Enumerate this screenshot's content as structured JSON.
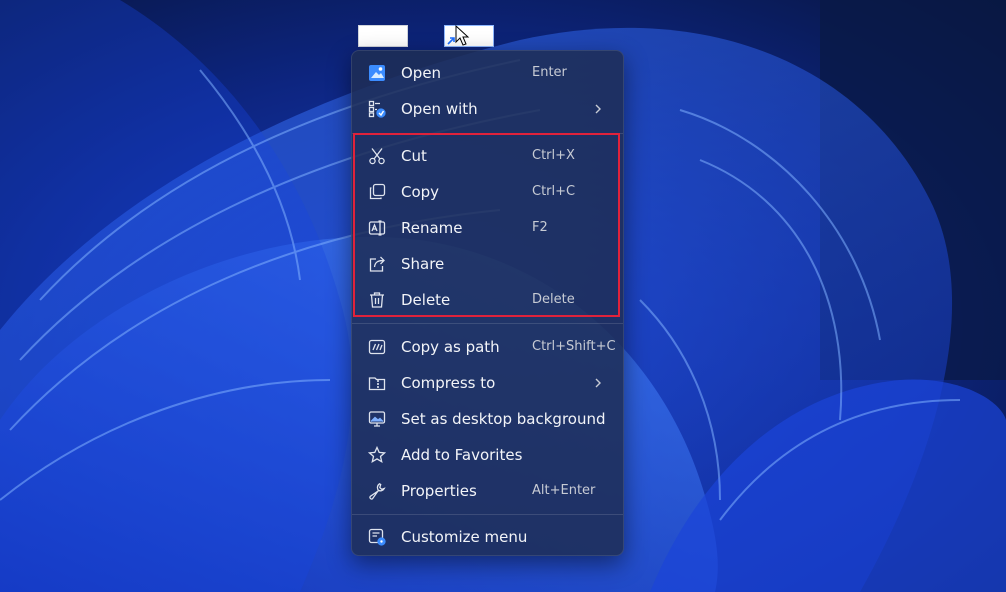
{
  "colors": {
    "highlight": "#e0223b",
    "menu_background": "#1e2d55",
    "menu_text": "#f2f4f8",
    "accent": "#1e5bff"
  },
  "menu": {
    "items": [
      {
        "label": "Open",
        "shortcut": "Enter",
        "icon": "image-file-icon"
      },
      {
        "label": "Open with",
        "shortcut": "",
        "icon": "open-with-icon",
        "submenu": true
      },
      {
        "label": "Cut",
        "shortcut": "Ctrl+X",
        "icon": "scissors-icon"
      },
      {
        "label": "Copy",
        "shortcut": "Ctrl+C",
        "icon": "copy-icon"
      },
      {
        "label": "Rename",
        "shortcut": "F2",
        "icon": "rename-icon"
      },
      {
        "label": "Share",
        "shortcut": "",
        "icon": "share-icon"
      },
      {
        "label": "Delete",
        "shortcut": "Delete",
        "icon": "trash-icon"
      },
      {
        "label": "Copy as path",
        "shortcut": "Ctrl+Shift+C",
        "icon": "copy-path-icon"
      },
      {
        "label": "Compress to",
        "shortcut": "",
        "icon": "zip-folder-icon",
        "submenu": true
      },
      {
        "label": "Set as desktop background",
        "shortcut": "",
        "icon": "desktop-background-icon"
      },
      {
        "label": "Add to Favorites",
        "shortcut": "",
        "icon": "star-icon"
      },
      {
        "label": "Properties",
        "shortcut": "Alt+Enter",
        "icon": "wrench-icon"
      },
      {
        "label": "Customize menu",
        "shortcut": "",
        "icon": "customize-menu-icon"
      }
    ]
  }
}
